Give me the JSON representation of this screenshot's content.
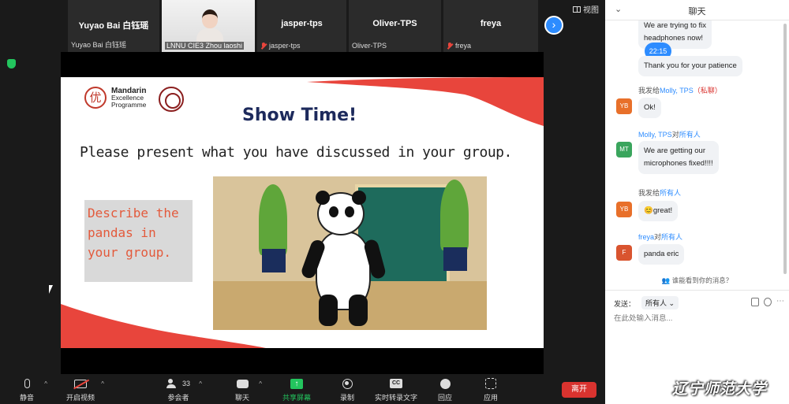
{
  "gallery": {
    "tiles": [
      {
        "name": "Yuyao Bai 白钰瑶",
        "label": "Yuyao Bai 白钰瑶",
        "muted": false
      },
      {
        "name": "",
        "label": "LNNU CIE3 Zhou laoshi",
        "muted": false,
        "video": true
      },
      {
        "name": "jasper-tps",
        "label": "jasper-tps",
        "muted": true
      },
      {
        "name": "Oliver-TPS",
        "label": "Oliver-TPS",
        "muted": false
      },
      {
        "name": "freya",
        "label": "freya",
        "muted": true
      }
    ],
    "next_label": "›",
    "view_label": "视图"
  },
  "slide": {
    "logo_char": "优",
    "logo_line1": "Mandarin",
    "logo_line2": "Excellence",
    "logo_line3": "Programme",
    "title": "Show Time!",
    "subtitle": "Please present what you have discussed in your group.",
    "task_text": "Describe the pandas in your group."
  },
  "toolbar": {
    "mute_label": "静音",
    "video_label": "开启视频",
    "participants_count": "33",
    "participants_label": "参会者",
    "chat_label": "聊天",
    "share_label": "共享屏幕",
    "record_label": "录制",
    "cc_label": "实时转录文字",
    "cc_icon_text": "CC",
    "reactions_label": "回应",
    "apps_label": "应用",
    "leave_label": "离开"
  },
  "chat": {
    "title": "聊天",
    "time_badge": "22:15",
    "messages": [
      {
        "text_top": "We are trying to fix",
        "text_bottom": "headphones now!"
      },
      {
        "text": "Thank you for your patience"
      },
      {
        "sender_prefix": "我发给",
        "sender_name": "Molly, TPS",
        "sender_suffix": "（私聊）",
        "avatar": "YB",
        "text": "Ok!"
      },
      {
        "sender_name": "Molly, TPS",
        "sender_to": "对",
        "sender_target": "所有人",
        "avatar": "MT",
        "text_line1": "We are getting our",
        "text_line2": "microphones fixed!!!!"
      },
      {
        "sender_prefix": "我发给",
        "sender_target": "所有人",
        "avatar": "YB",
        "text": "😊great!"
      },
      {
        "sender_name": "freya",
        "sender_to": "对",
        "sender_target": "所有人",
        "avatar": "F",
        "text": "panda eric"
      }
    ],
    "who_can_see": "谁能看到你的消息？",
    "send_to_label": "发送：",
    "recipient": "所有人 ⌄",
    "input_placeholder": "在此处输入消息..."
  },
  "watermark": "辽宁师范大学",
  "colors": {
    "accent_blue": "#2d8cff",
    "leave_red": "#d9332f",
    "share_green": "#23c55e",
    "slide_red": "#e8453c",
    "avatar_yb": "#e8702a",
    "avatar_mt": "#3aa55d",
    "avatar_f": "#d9542f"
  }
}
